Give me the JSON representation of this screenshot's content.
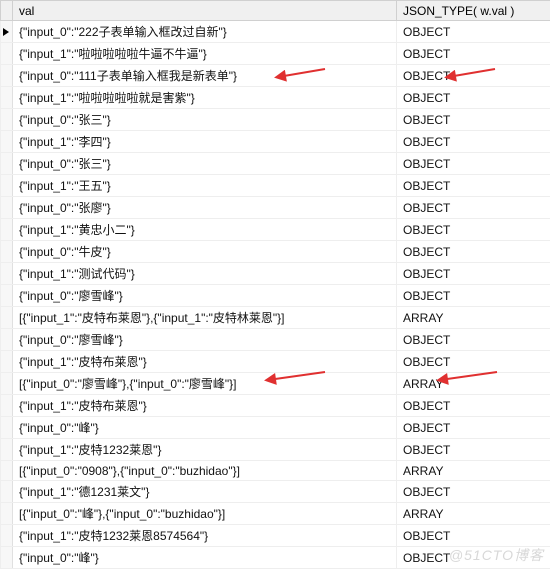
{
  "headers": {
    "col1": "val",
    "col2": "JSON_TYPE( w.val )"
  },
  "rows": [
    {
      "val": "{\"input_0\":\"222子表单输入框改过自新\"}",
      "type": "OBJECT",
      "current": true
    },
    {
      "val": "{\"input_1\":\"啦啦啦啦啦牛逼不牛逼\"}",
      "type": "OBJECT"
    },
    {
      "val": "{\"input_0\":\"111子表单输入框我是新表单\"}",
      "type": "OBJECT"
    },
    {
      "val": "{\"input_1\":\"啦啦啦啦啦就是害紫\"}",
      "type": "OBJECT"
    },
    {
      "val": "{\"input_0\":\"张三\"}",
      "type": "OBJECT"
    },
    {
      "val": "{\"input_1\":\"李四\"}",
      "type": "OBJECT"
    },
    {
      "val": "{\"input_0\":\"张三\"}",
      "type": "OBJECT"
    },
    {
      "val": "{\"input_1\":\"王五\"}",
      "type": "OBJECT"
    },
    {
      "val": "{\"input_0\":\"张廖\"}",
      "type": "OBJECT"
    },
    {
      "val": "{\"input_1\":\"黄忠小二\"}",
      "type": "OBJECT"
    },
    {
      "val": "{\"input_0\":\"牛皮\"}",
      "type": "OBJECT"
    },
    {
      "val": "{\"input_1\":\"测试代码\"}",
      "type": "OBJECT"
    },
    {
      "val": "{\"input_0\":\"廖雪峰\"}",
      "type": "OBJECT"
    },
    {
      "val": "[{\"input_1\":\"皮特布莱恩\"},{\"input_1\":\"皮特林莱恩\"}]",
      "type": "ARRAY"
    },
    {
      "val": "{\"input_0\":\"廖雪峰\"}",
      "type": "OBJECT"
    },
    {
      "val": "{\"input_1\":\"皮特布莱恩\"}",
      "type": "OBJECT"
    },
    {
      "val": "[{\"input_0\":\"廖雪峰\"},{\"input_0\":\"廖雪峰\"}]",
      "type": "ARRAY"
    },
    {
      "val": "{\"input_1\":\"皮特布莱恩\"}",
      "type": "OBJECT"
    },
    {
      "val": "{\"input_0\":\"峰\"}",
      "type": "OBJECT"
    },
    {
      "val": "{\"input_1\":\"皮特1232莱恩\"}",
      "type": "OBJECT"
    },
    {
      "val": "[{\"input_0\":\"0908\"},{\"input_0\":\"buzhidao\"}]",
      "type": "ARRAY"
    },
    {
      "val": "{\"input_1\":\"德1231莱文\"}",
      "type": "OBJECT"
    },
    {
      "val": "[{\"input_0\":\"峰\"},{\"input_0\":\"buzhidao\"}]",
      "type": "ARRAY"
    },
    {
      "val": "{\"input_1\":\"皮特1232莱恩8574564\"}",
      "type": "OBJECT"
    },
    {
      "val": "{\"input_0\":\"峰\"}",
      "type": "OBJECT"
    }
  ],
  "annotations": {
    "arrow_color": "#e03030"
  },
  "watermark": "@51CTO博客"
}
